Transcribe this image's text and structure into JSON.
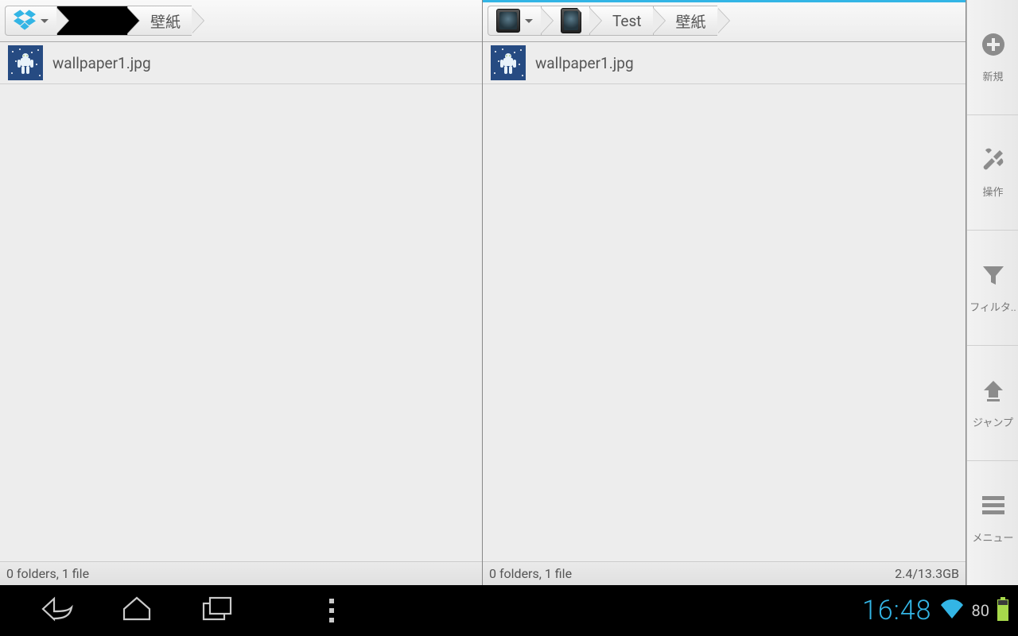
{
  "left_pane": {
    "breadcrumb": {
      "root_type": "dropbox",
      "redacted": "",
      "current": "壁紙"
    },
    "files": [
      {
        "name": "wallpaper1.jpg"
      }
    ],
    "status_left": "0 folders, 1 file",
    "status_right": ""
  },
  "right_pane": {
    "breadcrumb": {
      "root_type": "storage",
      "level1_type": "sd",
      "level2": "Test",
      "current": "壁紙"
    },
    "files": [
      {
        "name": "wallpaper1.jpg"
      }
    ],
    "status_left": "0 folders, 1 file",
    "status_right": "2.4/13.3GB"
  },
  "sidebar": {
    "items": [
      {
        "label": "新規"
      },
      {
        "label": "操作"
      },
      {
        "label": "フィルタ.."
      },
      {
        "label": "ジャンプ"
      },
      {
        "label": "メニュー"
      }
    ]
  },
  "navbar": {
    "clock": "16:48",
    "battery_pct": "80"
  }
}
